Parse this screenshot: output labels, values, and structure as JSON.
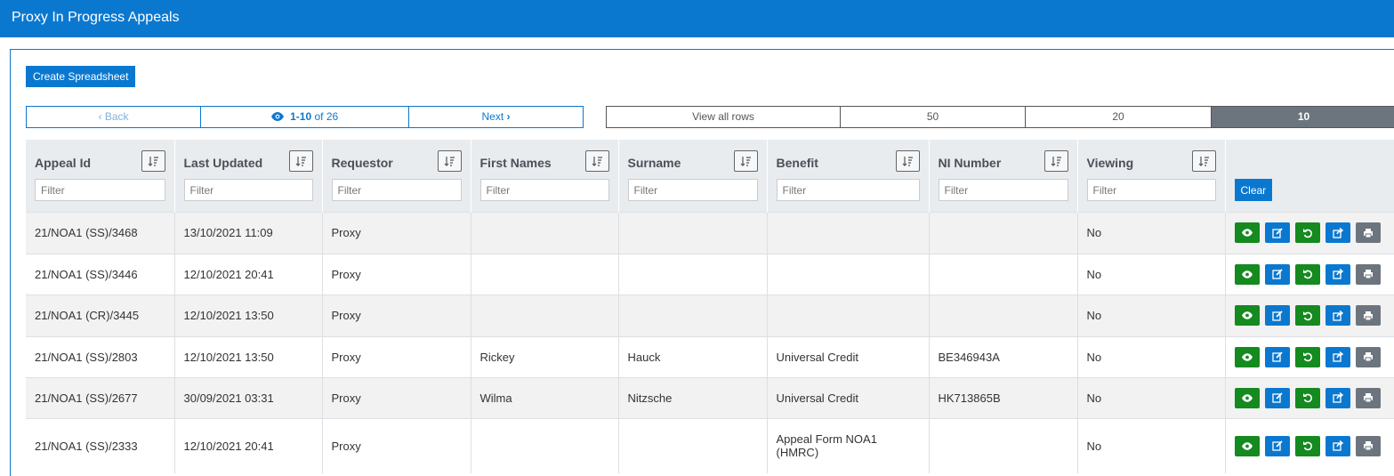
{
  "header": {
    "title": "Proxy In Progress Appeals"
  },
  "toolbar": {
    "create_label": "Create Spreadsheet"
  },
  "pager": {
    "back_label": "Back",
    "range": "1-10",
    "of_text": "of 26",
    "next_label": "Next"
  },
  "row_options": {
    "view_all": "View all rows",
    "opt_50": "50",
    "opt_20": "20",
    "opt_10": "10",
    "selected": "10"
  },
  "table": {
    "headers": [
      "Appeal Id",
      "Last Updated",
      "Requestor",
      "First Names",
      "Surname",
      "Benefit",
      "NI Number",
      "Viewing"
    ],
    "filter_placeholder": "Filter",
    "clear_label": "Clear",
    "rows": [
      {
        "appeal_id": "21/NOA1 (SS)/3468",
        "last_updated": "13/10/2021 11:09",
        "requestor": "Proxy",
        "first_names": "",
        "surname": "",
        "benefit": "",
        "ni_number": "",
        "viewing": "No"
      },
      {
        "appeal_id": "21/NOA1 (SS)/3446",
        "last_updated": "12/10/2021 20:41",
        "requestor": "Proxy",
        "first_names": "",
        "surname": "",
        "benefit": "",
        "ni_number": "",
        "viewing": "No"
      },
      {
        "appeal_id": "21/NOA1 (CR)/3445",
        "last_updated": "12/10/2021 13:50",
        "requestor": "Proxy",
        "first_names": "",
        "surname": "",
        "benefit": "",
        "ni_number": "",
        "viewing": "No"
      },
      {
        "appeal_id": "21/NOA1 (SS)/2803",
        "last_updated": "12/10/2021 13:50",
        "requestor": "Proxy",
        "first_names": "Rickey",
        "surname": "Hauck",
        "benefit": "Universal Credit",
        "ni_number": "BE346943A",
        "viewing": "No"
      },
      {
        "appeal_id": "21/NOA1 (SS)/2677",
        "last_updated": "30/09/2021 03:31",
        "requestor": "Proxy",
        "first_names": "Wilma",
        "surname": "Nitzsche",
        "benefit": "Universal Credit",
        "ni_number": "HK713865B",
        "viewing": "No"
      },
      {
        "appeal_id": "21/NOA1 (SS)/2333",
        "last_updated": "12/10/2021 20:41",
        "requestor": "Proxy",
        "first_names": "",
        "surname": "",
        "benefit": "Appeal Form NOA1 (HMRC)",
        "ni_number": "",
        "viewing": "No"
      }
    ],
    "actions": [
      {
        "name": "view-button",
        "icon": "eye-icon",
        "color": "#158a1f"
      },
      {
        "name": "edit-button",
        "icon": "edit-icon",
        "color": "#0b78d0"
      },
      {
        "name": "revert-button",
        "icon": "undo-icon",
        "color": "#158a1f"
      },
      {
        "name": "share-button",
        "icon": "share-icon",
        "color": "#0b78d0"
      },
      {
        "name": "print-button",
        "icon": "print-icon",
        "color": "#6c757d"
      }
    ]
  },
  "colors": {
    "brand": "#0b78d0",
    "success": "#158a1f",
    "secondary": "#6c757d"
  }
}
